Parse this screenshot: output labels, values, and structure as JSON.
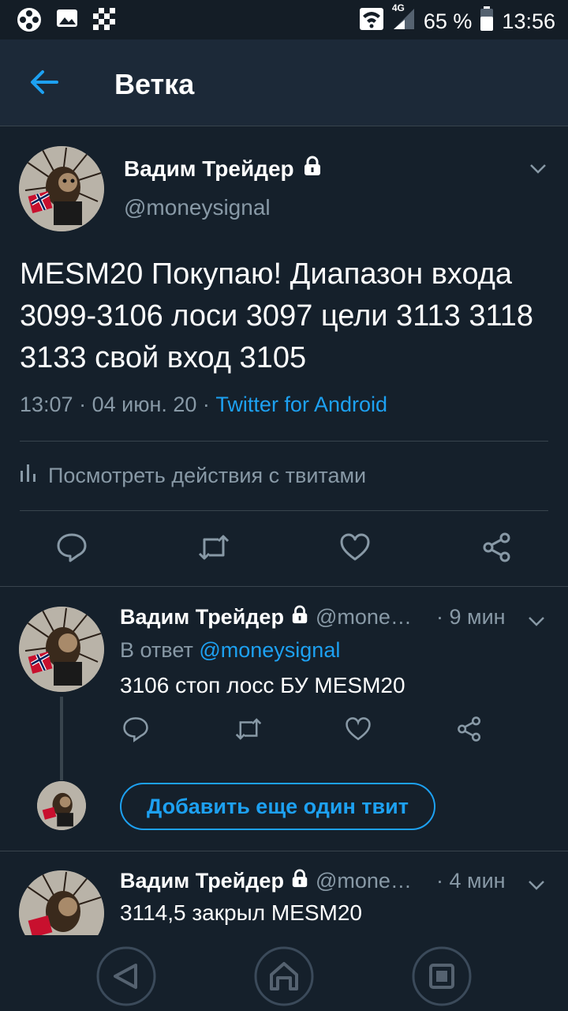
{
  "status_bar": {
    "network": "4G",
    "battery": "65 %",
    "time": "13:56"
  },
  "header": {
    "title": "Ветка"
  },
  "main_tweet": {
    "author": "Вадим Трейдер",
    "handle": "@moneysignal",
    "text": "MESM20 Покупаю! Диапазон входа 3099-3106 лоси 3097 цели 3113 3118 3133 свой вход 3105",
    "time": "13:07",
    "date": "04 июн. 20",
    "client": "Twitter for Android",
    "activity_label": "Посмотреть действия с твитами"
  },
  "replies": [
    {
      "author": "Вадим Трейдер",
      "handle": "@mone…",
      "age": "9 мин",
      "reply_prefix": "В ответ",
      "reply_to": "@moneysignal",
      "text": "3106 стоп лосс БУ MESM20"
    },
    {
      "author": "Вадим Трейдер",
      "handle": "@mone…",
      "age": "4 мин",
      "text": "3114,5 закрыл MESM20"
    }
  ],
  "add_tweet_label": "Добавить еще один твит",
  "colors": {
    "background": "#15202b",
    "accent": "#1da1f2",
    "muted": "#8899a6"
  },
  "icons": [
    "back-arrow-icon",
    "lock-icon",
    "chevron-down-icon",
    "reply-icon",
    "retweet-icon",
    "like-icon",
    "share-icon",
    "bar-chart-icon"
  ]
}
